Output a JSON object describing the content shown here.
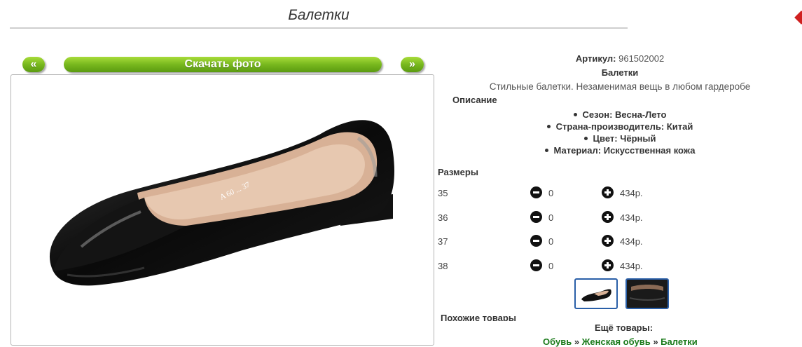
{
  "title": "Балетки",
  "nav": {
    "prev_label": "«",
    "download_label": "Скачать фото",
    "next_label": "»"
  },
  "product": {
    "article_label": "Артикул:",
    "article_value": "961502002",
    "name": "Балетки",
    "description": "Стильные балетки. Незаменимая вещь в любом гардеробе",
    "description_label": "Описание",
    "features": [
      "Сезон: Весна-Лето",
      "Страна-производитель: Китай",
      "Цвет: Чёрный",
      "Материал: Искусственная кожа"
    ],
    "insole_marking": "A 60 ... 37"
  },
  "sizes": {
    "label": "Размеры",
    "rows": [
      {
        "size": "35",
        "qty": "0",
        "price": "434р."
      },
      {
        "size": "36",
        "qty": "0",
        "price": "434р."
      },
      {
        "size": "37",
        "qty": "0",
        "price": "434р."
      },
      {
        "size": "38",
        "qty": "0",
        "price": "434р."
      }
    ]
  },
  "similar_label": "Похожие товары",
  "more_label": "Ещё товары:",
  "breadcrumbs": [
    "Обувь",
    "Женская обувь",
    "Балетки"
  ],
  "breadcrumb_separator": "»",
  "colors": {
    "button_green": "#78b81e",
    "link_green": "#1a7a1a",
    "thumb_border": "#2a5fa8"
  }
}
